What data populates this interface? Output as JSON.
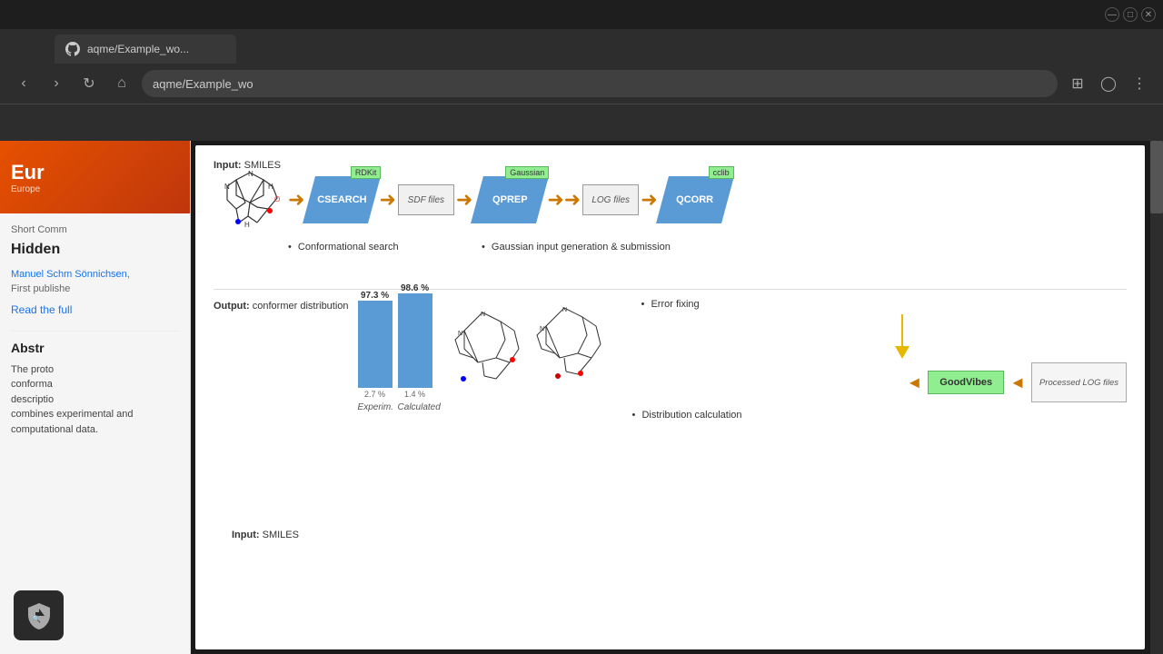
{
  "browser": {
    "tab_title": "aqme/Example_wo...",
    "address": "aqme/Example_wo",
    "github_label": "GitHub"
  },
  "site": {
    "title": "Eur",
    "subtitle": "Europe",
    "short_comm": "Short Comm",
    "article_title": "Hidden",
    "authors": "Manuel Schm\nSönnichsen,",
    "pub_date": "First publishe",
    "read_full": "Read the full",
    "abstract_title": "Abstr",
    "abstract_text_1": "The proto",
    "abstract_text_2": "conforma",
    "abstract_text_3": "descriptio",
    "abstract_text_4": "combines experimental and computational data."
  },
  "diagram": {
    "input_label": "Input:",
    "input_value": "SMILES",
    "output_label": "Output:",
    "output_value": "conformer distribution",
    "workflow": {
      "csearch": "CSEARCH",
      "csearch_tool": "RDKit",
      "sdf_files": "SDF files",
      "qprep": "QPREP",
      "qprep_tool": "Gaussian",
      "log_files": "LOG files",
      "qcorr": "QCORR",
      "qcorr_tool": "cclib",
      "conformational_search": "Conformational search",
      "gaussian_label": "Gaussian input generation & submission",
      "error_fixing": "Error fixing",
      "distribution_calc": "Distribution calculation"
    },
    "bottom_workflow": {
      "goodvibes": "GoodVibes",
      "processed_log": "Processed LOG files"
    },
    "chart": {
      "bar1_top": "97.3 %",
      "bar1_height": 100,
      "bar1_small": "2.7 %",
      "bar2_top": "98.6 %",
      "bar2_height": 108,
      "bar2_small": "1.4 %",
      "label1": "Experim.",
      "label2": "Calculated"
    }
  },
  "icons": {
    "back": "‹",
    "forward": "›",
    "refresh": "↻",
    "home": "⌂",
    "menu": "⋮",
    "extensions": "⊞",
    "profile": "◯",
    "arrow_right": "➜",
    "arrow_left": "◄",
    "arrow_down": "▼"
  },
  "window_controls": {
    "minimize": "—",
    "maximize": "□",
    "close": "✕"
  }
}
